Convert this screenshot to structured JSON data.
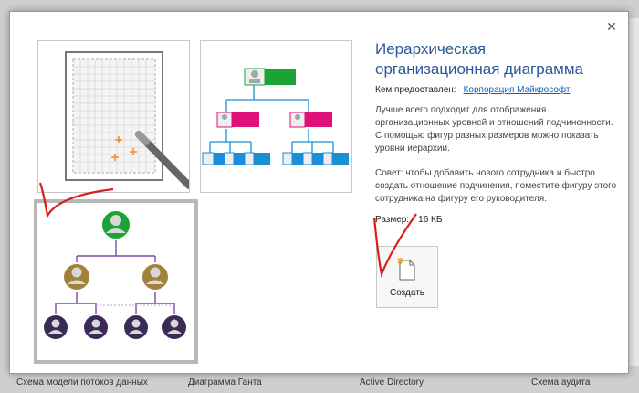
{
  "dialog": {
    "close_label": "✕",
    "title": "Иерархическая организационная диаграмма",
    "provider_label": "Кем предоставлен:",
    "provider_link": "Корпорация Майкрософт",
    "description": "Лучше всего подходит для отображения организационных уровней и отношений подчиненности. С помощью фигур разных размеров можно показать уровни иерархии.",
    "tip": "Совет: чтобы добавить нового сотрудника и быстро создать отношение подчинения, поместите фигуру этого сотрудника на фигуру его руководителя.",
    "size_label": "Размер:",
    "size_value": "16 КБ",
    "create_label": "Создать"
  },
  "background": {
    "templates": [
      "Схема модели потоков данных",
      "Диаграмма Ганта",
      "Active Directory",
      "Схема аудита"
    ]
  },
  "colors": {
    "title": "#2b579a",
    "link": "#0f5fb8",
    "annotation": "#d62020",
    "org_green": "#1ba336",
    "org_magenta": "#e0107a",
    "org_blue": "#1a8fd8",
    "org_gold": "#a2823b",
    "org_purple": "#3b2a55"
  }
}
